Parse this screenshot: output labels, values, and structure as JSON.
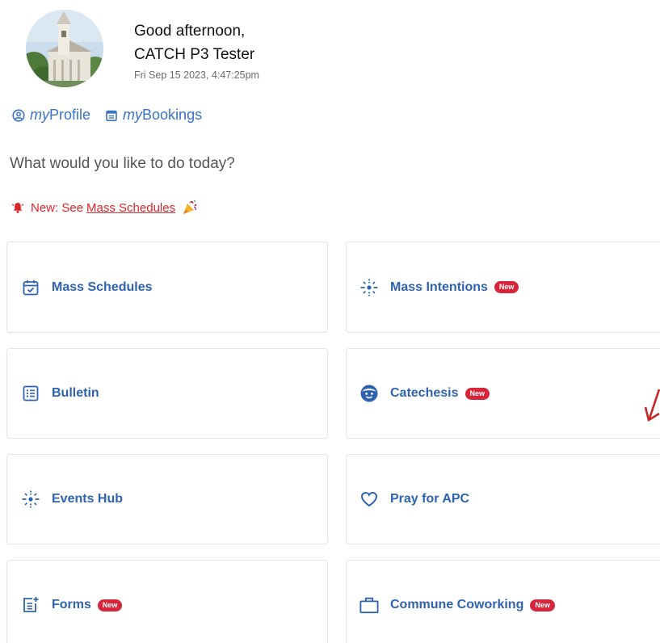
{
  "header": {
    "greeting": "Good afternoon,",
    "user_name": "CATCH P3 Tester",
    "datetime": "Fri Sep 15 2023, 4:47:25pm"
  },
  "links": {
    "profile_prefix": "my",
    "profile_label": "Profile",
    "bookings_prefix": "my",
    "bookings_label": "Bookings"
  },
  "prompt": "What would you like to do today?",
  "announcement": {
    "prefix": "New: See",
    "link_text": "Mass Schedules"
  },
  "cards": [
    {
      "label": "Mass Schedules",
      "icon": "calendar-check-icon",
      "badge": ""
    },
    {
      "label": "Mass Intentions",
      "icon": "sparkle-icon",
      "badge": "New"
    },
    {
      "label": "Bulletin",
      "icon": "list-icon",
      "badge": ""
    },
    {
      "label": "Catechesis",
      "icon": "child-face-icon",
      "badge": "New"
    },
    {
      "label": "Events Hub",
      "icon": "sparkle-icon",
      "badge": ""
    },
    {
      "label": "Pray for APC",
      "icon": "heart-icon",
      "badge": ""
    },
    {
      "label": "Forms",
      "icon": "form-add-icon",
      "badge": "New"
    },
    {
      "label": "Commune Coworking",
      "icon": "briefcase-icon",
      "badge": "New"
    }
  ],
  "colors": {
    "accent": "#2f63b2",
    "link": "#3a73c6",
    "alert": "#d9262b",
    "badge": "#d7263b"
  }
}
